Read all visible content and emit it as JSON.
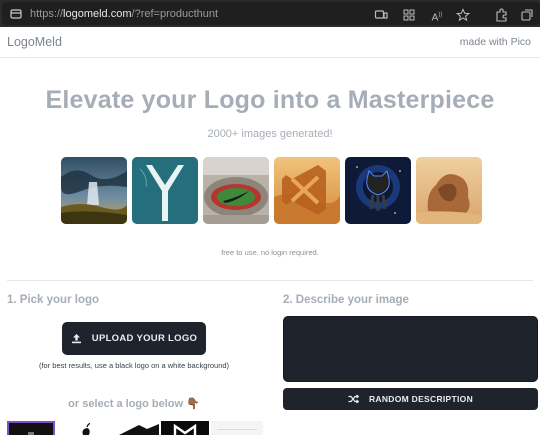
{
  "browser": {
    "url_prefix": "https://",
    "url_host": "logomeld.com",
    "url_rest": "/?ref=producthunt"
  },
  "header": {
    "brand": "LogoMeld",
    "made_with": "made with Pico"
  },
  "hero": {
    "title": "Elevate your Logo into a Masterpiece",
    "subtitle": "2000+ images generated!",
    "free_note": "free to use. no login required."
  },
  "step1": {
    "title": "1. Pick your logo",
    "upload_label": "UPLOAD YOUR LOGO",
    "hint": "(for best results, use a black logo on a white background)",
    "or_select": "or select a logo below 👇🏾"
  },
  "step2": {
    "title": "2. Describe your image",
    "description_value": "",
    "random_label": "RANDOM DESCRIPTION"
  },
  "gallery": [
    {
      "icon": "stormy-landscape-image"
    },
    {
      "icon": "aerial-boat-y-image"
    },
    {
      "icon": "stadium-nike-image"
    },
    {
      "icon": "desert-vscode-image"
    },
    {
      "icon": "space-github-cat-image"
    },
    {
      "icon": "sand-sculpture-image"
    }
  ],
  "colors": {
    "accent_dark": "#1f242c",
    "muted_text": "#a6adb6",
    "selected_outline": "#7b4fd1"
  }
}
